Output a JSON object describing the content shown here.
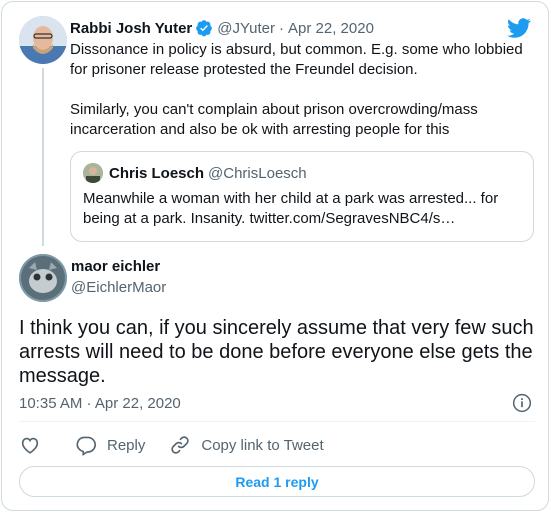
{
  "parent_tweet": {
    "author_name": "Rabbi Josh Yuter",
    "author_handle": "@JYuter",
    "separator": "·",
    "date": "Apr 22, 2020",
    "text_paragraph_1": "Dissonance in policy is absurd, but common. E.g. some who lobbied for prisoner release protested the Freundel decision.",
    "text_paragraph_2": "Similarly, you can't complain about prison overcrowding/mass incarceration and also be ok with arresting people for this",
    "quoted_tweet": {
      "author_name": "Chris Loesch",
      "author_handle": "@ChrisLoesch",
      "text": "Meanwhile a woman with her child at a park was arrested... for being at a park. Insanity. twitter.com/SegravesNBC4/s…"
    }
  },
  "main_tweet": {
    "author_name": "maor eichler",
    "author_handle": "@EichlerMaor",
    "text": "I think you can, if you sincerely assume that very few such arrests will need to be done before everyone else gets the message.",
    "timestamp": "10:35 AM · Apr 22, 2020"
  },
  "actions": {
    "reply_label": "Reply",
    "copy_link_label": "Copy link to Tweet"
  },
  "read_replies_label": "Read 1 reply",
  "colors": {
    "twitter_blue": "#1d9bf0",
    "secondary_text": "#536471",
    "border": "#cfd9de"
  },
  "icons": [
    "twitter-bird-icon",
    "verified-badge-icon",
    "info-icon",
    "heart-icon",
    "reply-icon",
    "link-icon"
  ]
}
